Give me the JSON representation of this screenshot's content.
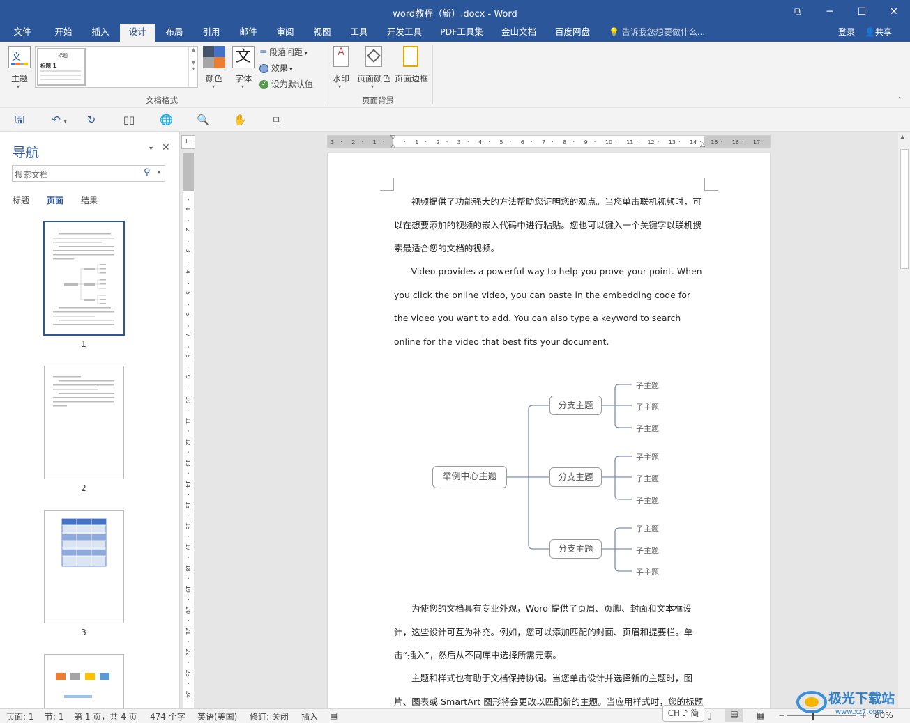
{
  "window": {
    "title": "word教程（新）.docx - Word"
  },
  "tabs": [
    "文件",
    "开始",
    "插入",
    "设计",
    "布局",
    "引用",
    "邮件",
    "审阅",
    "视图",
    "工具",
    "开发工具",
    "PDF工具集",
    "金山文档",
    "百度网盘"
  ],
  "active_tab": "设计",
  "tell_me": "告诉我您想要做什么...",
  "account": {
    "login": "登录",
    "share": "共享"
  },
  "ribbon": {
    "theme": "主题",
    "style_preview": {
      "title": "标题",
      "heading1": "标题 1"
    },
    "colors": "颜色",
    "fonts": "字体",
    "font_glyph": "文",
    "paragraph_spacing": "段落间距",
    "effects": "效果",
    "set_default": "设为默认值",
    "group_format": "文档格式",
    "watermark": "水印",
    "page_color": "页面颜色",
    "page_border": "页面边框",
    "group_background": "页面背景"
  },
  "nav": {
    "title": "导航",
    "search_placeholder": "搜索文档",
    "tabs": [
      "标题",
      "页面",
      "结果"
    ],
    "active_tab": "页面",
    "pages": [
      "1",
      "2",
      "3"
    ]
  },
  "document": {
    "paragraphs": [
      "视频提供了功能强大的方法帮助您证明您的观点。当您单击联机视频时，可以在想要添加的视频的嵌入代码中进行粘贴。您也可以键入一个关键字以联机搜索最适合您的文档的视频。",
      "Video provides a powerful way to help you prove your point. When you click the online video, you can paste in the embedding code for the video you want to add. You can also type a keyword to search online for the video that best fits your document.",
      "为使您的文档具有专业外观，Word 提供了页眉、页脚、封面和文本框设计，这些设计可互为补充。例如，您可以添加匹配的封面、页眉和提要栏。单击“插入”，然后从不同库中选择所需元素。",
      "主题和样式也有助于文档保持协调。当您单击设计并选择新的主题时，图片、图表或 SmartArt 图形将会更改以匹配新的主题。当应用样式时，您的标题会进"
    ],
    "mindmap": {
      "center": "举例中心主题",
      "branches": [
        {
          "label": "分支主题",
          "leaves": [
            "子主题",
            "子主题",
            "子主题"
          ]
        },
        {
          "label": "分支主题",
          "leaves": [
            "子主题",
            "子主题",
            "子主题"
          ]
        },
        {
          "label": "分支主题",
          "leaves": [
            "子主题",
            "子主题",
            "子主题"
          ]
        }
      ]
    }
  },
  "status": {
    "page": "页面: 1",
    "section": "节: 1",
    "page_of": "第 1 页，共 4 页",
    "words": "474 个字",
    "language": "英语(美国)",
    "track": "修订: 关闭",
    "insert": "插入",
    "ime": "CH ♪ 简",
    "zoom": "80%"
  },
  "colors": {
    "accent": "#2b579a"
  }
}
